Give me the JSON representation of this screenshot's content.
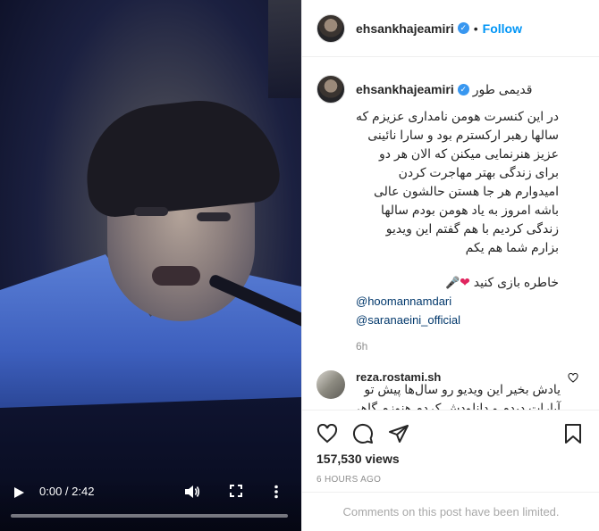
{
  "video": {
    "current_time": "0:00",
    "separator": " / ",
    "duration": "2:42",
    "progress_fraction": 0.0,
    "play_icon": "play-icon",
    "volume_icon": "volume-icon",
    "fullscreen_icon": "fullscreen-icon",
    "more_icon": "more-options-icon"
  },
  "header": {
    "username": "ehsankhajeamiri",
    "verified": true,
    "dot": "•",
    "follow_label": "Follow"
  },
  "caption": {
    "username": "ehsankhajeamiri",
    "prefix": "قدیمی طور",
    "body": "در این کنسرت هومن نامداری عزیزم که سالها رهبر ارکسترم بود و سارا نائینی عزیز هنرنمایی میکنن که الان هر دو برای زندگی بهتر مهاجرت کردن امیدوارم هر جا هستن حالشون عالی باشه امروز به یاد هومن بودم سالها زندگی کردیم با هم گفتم این ویدیو بزارم شما هم یکم",
    "emoji_line": "خاطره بازی کنید",
    "mentions": [
      "@hoomannamdari",
      "@saranaeini_official"
    ],
    "age": "6h"
  },
  "comment": {
    "username": "reza.rostami.sh",
    "text": "یادش بخیر این ویدیو رو سال‌ها پیش تو آپارات دیدم و دانلودش کردم هنوزم گاهی وقتا می‌بینمش"
  },
  "stats": {
    "views": "157,530 views",
    "time_ago": "6 HOURS AGO"
  },
  "footer": {
    "limited_text": "Comments on this post have been limited."
  },
  "colors": {
    "accent": "#0095f6",
    "verified": "#3897f0",
    "heart": "#e0245e"
  }
}
